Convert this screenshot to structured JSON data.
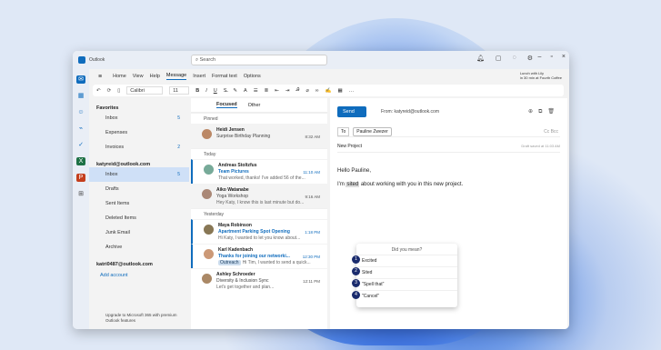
{
  "app": {
    "name": "Outlook"
  },
  "search": {
    "placeholder": "Search"
  },
  "menu": {
    "items": [
      "Home",
      "View",
      "Help",
      "Message",
      "Insert",
      "Format text",
      "Options"
    ]
  },
  "lunch": {
    "line1": "Lunch with Lily",
    "line2": "in 30 min at Fourth Coffee"
  },
  "toolbar": {
    "font": "Calibri",
    "size": "11"
  },
  "folders": {
    "favorites_label": "Favorites",
    "favorites": [
      {
        "label": "Inbox",
        "count": "5"
      },
      {
        "label": "Expenses",
        "count": ""
      },
      {
        "label": "Invoices",
        "count": "2"
      }
    ],
    "account1": "katyreid@outlook.com",
    "account1_items": [
      {
        "label": "Inbox",
        "count": "5"
      },
      {
        "label": "Drafts",
        "count": ""
      },
      {
        "label": "Sent Items",
        "count": ""
      },
      {
        "label": "Deleted Items",
        "count": ""
      },
      {
        "label": "Junk Email",
        "count": ""
      },
      {
        "label": "Archive",
        "count": ""
      }
    ],
    "account2": "katri0487@outlook.com",
    "add_account": "Add account",
    "upgrade": "Upgrade to Microsoft 365 with premium Outlook features"
  },
  "list": {
    "tab_focused": "Focused",
    "tab_other": "Other",
    "group_pinned": "Pinned",
    "group_today": "Today",
    "group_yesterday": "Yesterday",
    "messages": [
      {
        "sender": "Heidi Jensen",
        "subject": "Surprise Birthday Planning",
        "preview": "",
        "time": "8:32 AM"
      },
      {
        "sender": "Andreas Stoltzfus",
        "subject": "Team Pictures",
        "preview": "That worked, thanks! I've added 56 of the...",
        "time": "11:10 AM"
      },
      {
        "sender": "Aiko Watanabe",
        "subject": "Yoga Workshop",
        "preview": "Hey Katy, I know this is last minute but do...",
        "time": "9:16 AM"
      },
      {
        "sender": "Maya Robinson",
        "subject": "Apartment Parking Spot Opening",
        "preview": "Hi Katy, I wanted to let you know about...",
        "time": "1:18 PM"
      },
      {
        "sender": "Karl Kadenbach",
        "subject": "Thanks for joining our networki...",
        "preview": "Hi Tim, I wanted to send a quick...",
        "time": "12:30 PM",
        "tag": "Outreach"
      },
      {
        "sender": "Ashley Schroeder",
        "subject": "Diversity & Inclusion Sync",
        "preview": "Let's get together and plan...",
        "time": "12:11 PM"
      }
    ]
  },
  "compose": {
    "send": "Send",
    "from": "From: katyreid@outlook.com",
    "to_label": "To",
    "recipient": "Pauline Zwezer",
    "cc": "Cc Bcc",
    "subject": "New Project",
    "draft_saved": "Draft saved at 11:03 AM",
    "greeting": "Hello Pauline,",
    "body_pre": "I'm ",
    "body_word": "sited",
    "body_post": " about working with you in this new project.",
    "suggest_header": "Did you mean?",
    "suggestions": [
      {
        "n": "1",
        "text": "Excited"
      },
      {
        "n": "2",
        "text": "Sited"
      },
      {
        "n": "3",
        "text": "\"Spell that\""
      },
      {
        "n": "4",
        "text": "\"Cancel\""
      }
    ]
  }
}
